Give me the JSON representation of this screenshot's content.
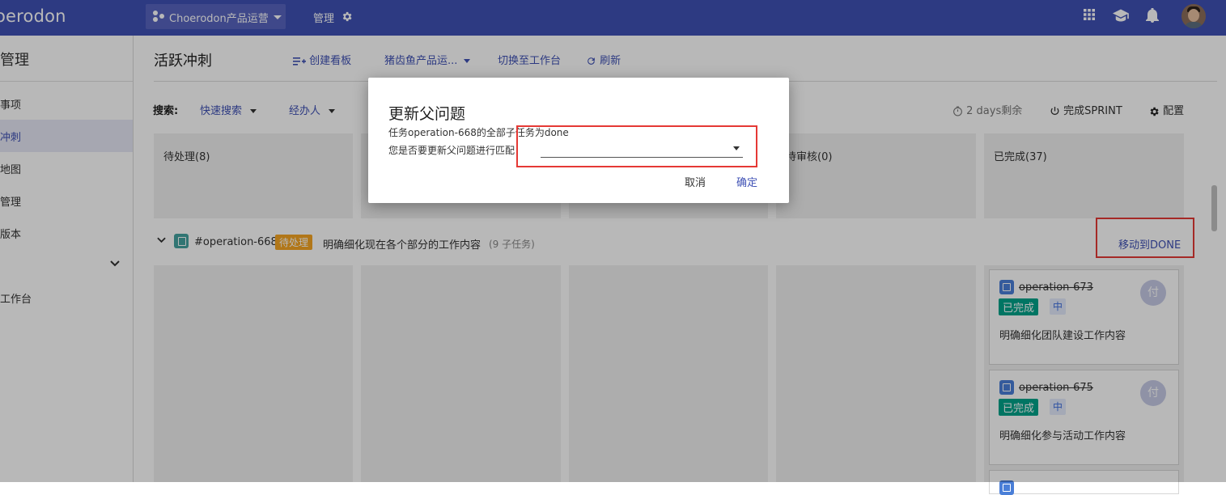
{
  "topbar": {
    "logo": "oerodon",
    "project": "Choerodon产品运营",
    "manage": "管理",
    "icons": [
      "apps-grid-icon",
      "school-cap-icon",
      "bell-icon",
      "avatar"
    ]
  },
  "sidebar": {
    "title": "管理",
    "items": [
      {
        "label": "事项"
      },
      {
        "label": "冲刺",
        "active": true
      },
      {
        "label": "地图"
      },
      {
        "label": "管理"
      },
      {
        "label": "版本"
      },
      {
        "label": "工作台"
      }
    ]
  },
  "header": {
    "title": "活跃冲刺",
    "create_board": "创建看板",
    "board_select": "猪齿鱼产品运...",
    "switch_workbench": "切换至工作台",
    "refresh": "刷新"
  },
  "filters": {
    "label": "搜索:",
    "quick_search": "快速搜索",
    "assignee": "经办人"
  },
  "tools": {
    "days_left": "2 days剩余",
    "complete_sprint": "完成SPRINT",
    "settings": "配置"
  },
  "columns": [
    {
      "label": "待处理(8)"
    },
    {
      "label": ""
    },
    {
      "label": ""
    },
    {
      "label": "待审核(0)"
    },
    {
      "label": "已完成(37)"
    }
  ],
  "swimlane": {
    "key": "#operation-668",
    "status": "待处理",
    "summary": "明确细化现在各个部分的工作内容",
    "subtasks": "(9 子任务)",
    "move_done": "移动到DONE"
  },
  "cards": [
    {
      "key": "operation-673",
      "status": "已完成",
      "priority": "中",
      "assignee": "付",
      "summary": "明确细化团队建设工作内容"
    },
    {
      "key": "operation-675",
      "status": "已完成",
      "priority": "中",
      "assignee": "付",
      "summary": "明确细化参与活动工作内容"
    }
  ],
  "dialog": {
    "title": "更新父问题",
    "text1": "任务operation-668的全部子任务为done",
    "text2": "您是否要更新父问题进行匹配",
    "select_value": "",
    "cancel": "取消",
    "ok": "确定"
  },
  "colors": {
    "primary": "#3f51b5",
    "pending": "#f5a623",
    "done": "#00a38a",
    "highlight": "#e53935"
  }
}
